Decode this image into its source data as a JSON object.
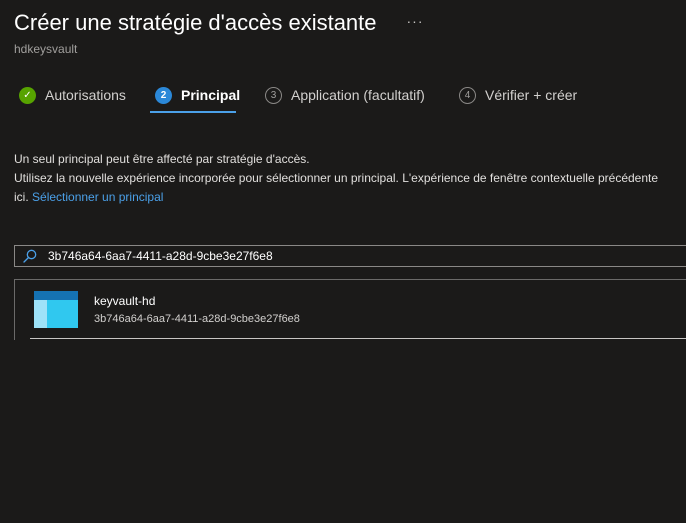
{
  "header": {
    "title": "Créer une stratégie d'accès existante",
    "more_label": "···",
    "subtitle": "hdkeysvault"
  },
  "tabs": [
    {
      "label": "Autorisations",
      "step": "✓",
      "state": "done"
    },
    {
      "label": "Principal",
      "step": "2",
      "state": "active"
    },
    {
      "label": "Application (facultatif)",
      "step": "3",
      "state": "pending"
    },
    {
      "label": "Vérifier + créer",
      "step": "4",
      "state": "pending"
    }
  ],
  "info": {
    "line1": "Un seul principal peut être affecté par stratégie d'accès.",
    "line2": "Utilisez la nouvelle expérience incorporée pour sélectionner un principal. L'expérience de fenêtre contextuelle précédente",
    "line3_prefix": "ici.",
    "link": "Sélectionner un principal"
  },
  "search": {
    "value": "3b746a64-6aa7-4411-a28d-9cbe3e27f6e8",
    "icon": "search-icon"
  },
  "results": [
    {
      "name": "keyvault-hd",
      "id": "3b746a64-6aa7-4411-a28d-9cbe3e27f6e8",
      "icon": "app-registration-icon"
    }
  ],
  "colors": {
    "background": "#1b1a19",
    "accent": "#4ba0e8",
    "success": "#57a300"
  }
}
